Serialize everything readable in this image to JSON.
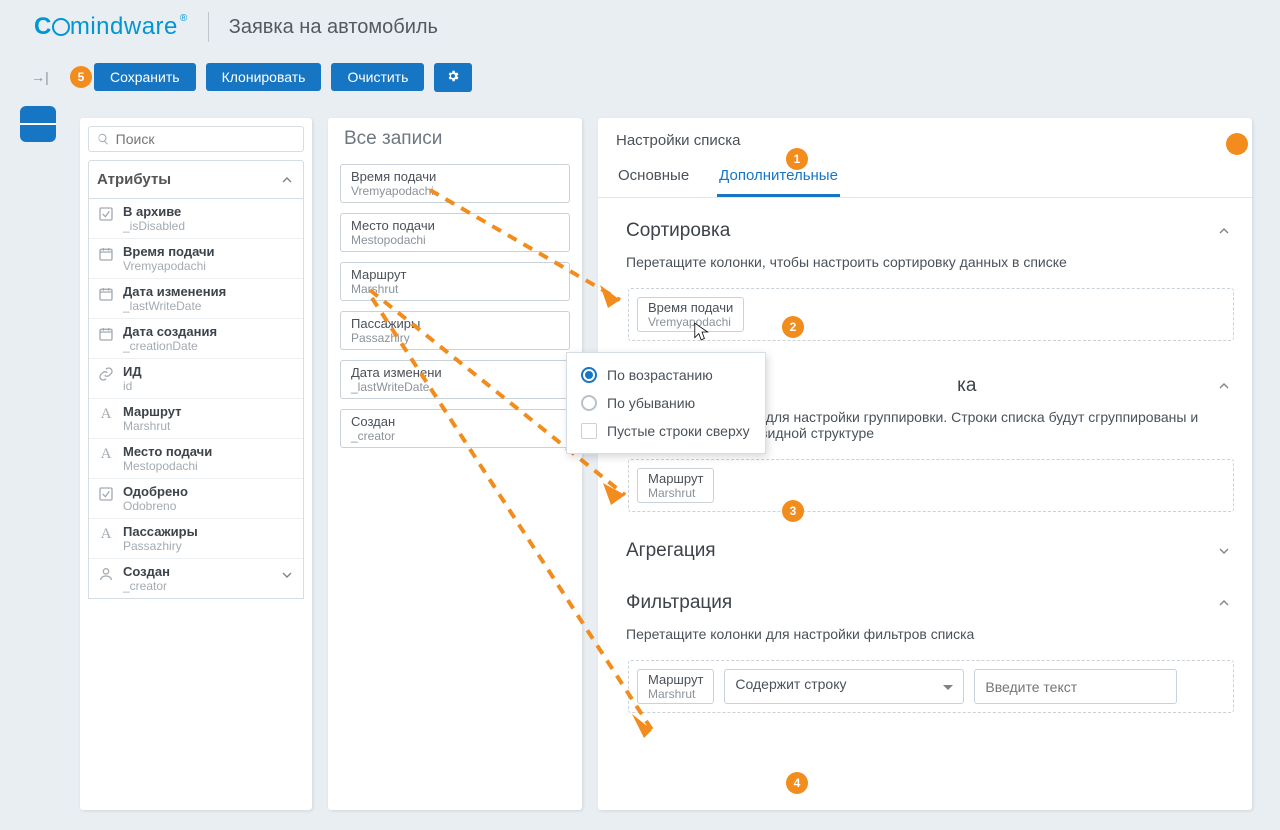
{
  "header": {
    "brand": "Comindware",
    "page_title": "Заявка на автомобиль"
  },
  "toolbar": {
    "save": "Сохранить",
    "clone": "Клонировать",
    "clear": "Очистить"
  },
  "left": {
    "search_placeholder": "Поиск",
    "accordion_title": "Атрибуты",
    "attrs": [
      {
        "icon": "check",
        "l1": "В архиве",
        "l2": "_isDisabled"
      },
      {
        "icon": "cal",
        "l1": "Время подачи",
        "l2": "Vremyapodachi"
      },
      {
        "icon": "cal",
        "l1": "Дата изменения",
        "l2": "_lastWriteDate"
      },
      {
        "icon": "cal",
        "l1": "Дата создания",
        "l2": "_creationDate"
      },
      {
        "icon": "link",
        "l1": "ИД",
        "l2": "id"
      },
      {
        "icon": "A",
        "l1": "Маршрут",
        "l2": "Marshrut"
      },
      {
        "icon": "A",
        "l1": "Место подачи",
        "l2": "Mestopodachi"
      },
      {
        "icon": "check",
        "l1": "Одобрено",
        "l2": "Odobreno"
      },
      {
        "icon": "A",
        "l1": "Пассажиры",
        "l2": "Passazhiry"
      },
      {
        "icon": "user",
        "l1": "Создан",
        "l2": "_creator",
        "chev": true
      }
    ]
  },
  "mid": {
    "title": "Все записи",
    "pills": [
      {
        "l1": "Время подачи",
        "l2": "Vremyapodachi"
      },
      {
        "l1": "Место подачи",
        "l2": "Mestopodachi"
      },
      {
        "l1": "Маршрут",
        "l2": "Marshrut"
      },
      {
        "l1": "Пассажиры",
        "l2": "Passazhiry"
      },
      {
        "l1": "Дата изменени",
        "l2": "_lastWriteDate"
      },
      {
        "l1": "Создан",
        "l2": "_creator"
      }
    ]
  },
  "right": {
    "title": "Настройки списка",
    "tabs": {
      "main": "Основные",
      "extra": "Дополнительные"
    },
    "sort": {
      "hdr": "Сортировка",
      "hint": "Перетащите колонки, чтобы настроить сортировку данных в списке",
      "chip": {
        "l1": "Время подачи",
        "l2": "Vremyapodachi"
      }
    },
    "group_tail": "ка",
    "group_hint": "Перетащите колонки для настройки группировки. Строки списка будут сгруппированы и отображены в древовидной структуре",
    "group_chip": {
      "l1": "Маршрут",
      "l2": "Marshrut"
    },
    "agg": "Агрегация",
    "filter": {
      "hdr": "Фильтрация",
      "hint": "Перетащите колонки для настройки фильтров списка",
      "chip": {
        "l1": "Маршрут",
        "l2": "Marshrut"
      },
      "operator": "Содержит строку",
      "input_placeholder": "Введите текст"
    }
  },
  "popup": {
    "asc": "По возрастанию",
    "desc": "По убыванию",
    "blank_top": "Пустые строки сверху"
  },
  "steps": {
    "s1": "1",
    "s2": "2",
    "s3": "3",
    "s4": "4",
    "s5": "5"
  }
}
